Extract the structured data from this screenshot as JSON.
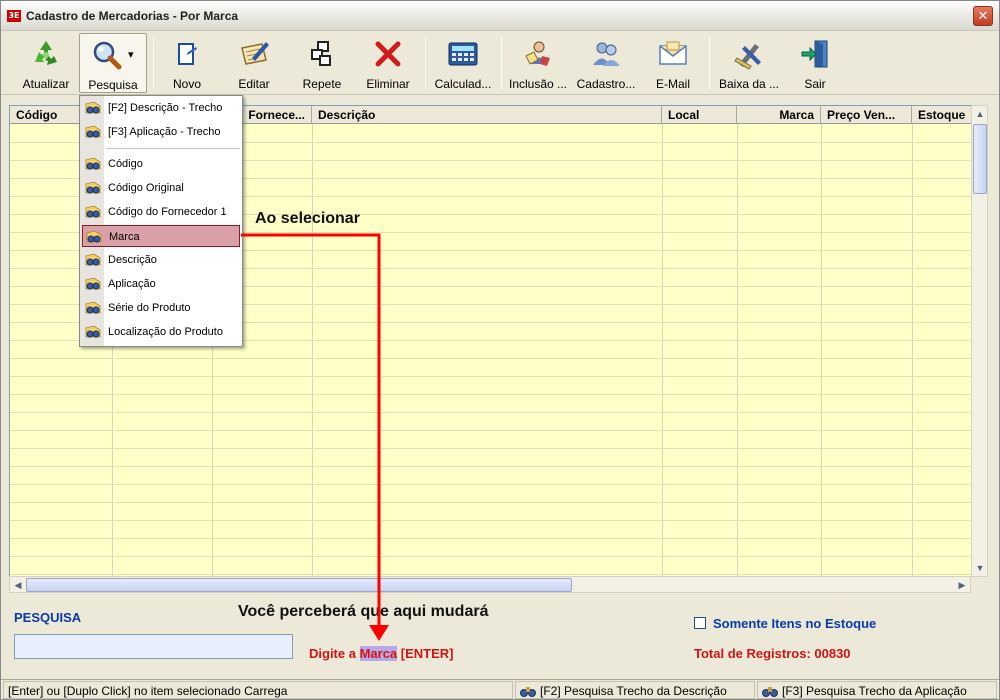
{
  "window": {
    "title": "Cadastro de Mercadorias - Por Marca",
    "close_glyph": "✕"
  },
  "toolbar": {
    "buttons": [
      {
        "label": "Atualizar",
        "icon": "recycle-icon"
      },
      {
        "label": "Pesquisa",
        "icon": "magnifier-icon"
      },
      {
        "label": "Novo",
        "icon": "new-document-icon"
      },
      {
        "label": "Editar",
        "icon": "edit-document-icon"
      },
      {
        "label": "Repete",
        "icon": "copy-icon"
      },
      {
        "label": "Eliminar",
        "icon": "delete-x-icon"
      },
      {
        "label": "Calculad...",
        "icon": "calculator-icon"
      },
      {
        "label": "Inclusão ...",
        "icon": "inclusion-icon"
      },
      {
        "label": "Cadastro...",
        "icon": "users-icon"
      },
      {
        "label": "E-Mail",
        "icon": "envelope-icon"
      },
      {
        "label": "Baixa da ...",
        "icon": "tools-icon"
      },
      {
        "label": "Sair",
        "icon": "exit-door-icon"
      }
    ],
    "dropdown_glyph": "▾"
  },
  "grid": {
    "columns": [
      "Código",
      "",
      "Fornece...",
      "Descrição",
      "Local",
      "Marca",
      "Preço Ven...",
      "Estoque"
    ]
  },
  "menu": {
    "items": [
      "[F2] Descrição - Trecho",
      "[F3] Aplicação - Trecho",
      "Código",
      "Código Original",
      "Código do Fornecedor 1",
      "Marca",
      "Descrição",
      "Aplicação",
      "Série do Produto",
      "Localização do Produto"
    ],
    "selected": "Marca"
  },
  "annotations": {
    "top": "Ao selecionar",
    "bottom": "Você perceberá que aqui mudará",
    "arrow_color": "#ff0000"
  },
  "search": {
    "label": "PESQUISA",
    "value": "",
    "hint_prefix": "Digite a ",
    "hint_field": "Marca",
    "hint_suffix": " [ENTER]"
  },
  "filters": {
    "stock_only_label": "Somente Itens no Estoque",
    "stock_only_checked": false
  },
  "totals": {
    "label": "Total de Registros: 00830"
  },
  "statusbar": {
    "left": "[Enter] ou [Duplo Click] no item selecionado Carrega",
    "mid": "[F2] Pesquisa Trecho da Descrição",
    "right": "[F3] Pesquisa Trecho da Aplicação"
  },
  "colors": {
    "grid_bg": "#ffffc8",
    "menu_selected": "#d9a0a8",
    "label_blue": "#0a3aa8",
    "label_red": "#d21414"
  }
}
